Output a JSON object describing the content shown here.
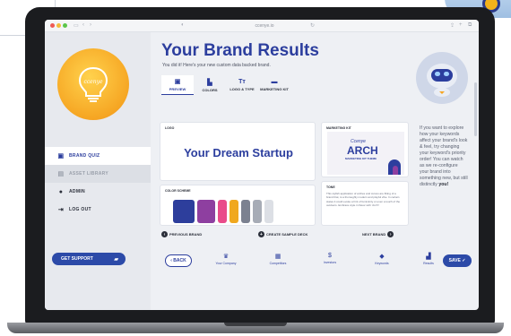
{
  "browser": {
    "url": "ccenye.io"
  },
  "sidebar": {
    "items": [
      {
        "label": "BRAND QUIZ",
        "icon": "quiz-icon"
      },
      {
        "label": "ASSET LIBRARY",
        "icon": "library-icon"
      },
      {
        "label": "ADMIN",
        "icon": "admin-icon"
      },
      {
        "label": "LOG OUT",
        "icon": "logout-icon"
      }
    ],
    "support_label": "GET SUPPORT"
  },
  "main": {
    "title": "Your Brand Results",
    "subtitle": "You did it! Here's your new custom data backed brand.",
    "tabs": [
      {
        "label": "PREVIEW"
      },
      {
        "label": "COLORS"
      },
      {
        "label": "LOGO & TYPE"
      },
      {
        "label": "MARKETING KIT"
      }
    ],
    "logo_card": {
      "label": "LOGO",
      "text": "Your Dream Startup"
    },
    "marketing_card": {
      "label": "MARKETING KIT",
      "script": "Ccenye",
      "headline": "ARCH",
      "sub": "MARKETING KIT THEME"
    },
    "color_card": {
      "label": "COLOR SCHEME",
      "swatches": [
        "#2d3e9c",
        "#8e3fa0",
        "#e94b8a",
        "#f0a81f",
        "#7b8190",
        "#a7acb6",
        "#dcdfe5"
      ]
    },
    "tone_card": {
      "label": "TONE",
      "text": "This stylish application of arches and curves are fitting of a brand that, is a thoroughly modern and playful vibe. In certain states it could evoke a hint of femininity or even a touch of the outdoors. Embrace style in flavor with 'Arch'!"
    },
    "brand_nav": {
      "previous": "PREVIOUS BRAND",
      "create": "CREATE SAMPLE DECK",
      "next": "NEXT BRAND"
    },
    "side_note": "If you want to explore how your keywords affect your brand's look & feel, try changing your keyword's priority order! You can watch as we re-configure your brand into something new, but still distinctly",
    "side_note_bold": "you!",
    "footer": {
      "back": "BACK",
      "steps": [
        "Your Company",
        "Competitors",
        "Investors",
        "Keywords",
        "Results"
      ],
      "save": "SAVE"
    }
  }
}
